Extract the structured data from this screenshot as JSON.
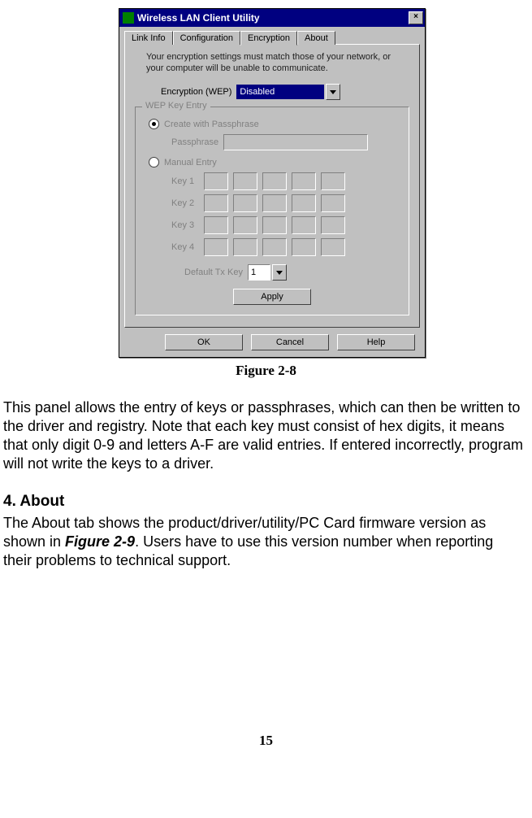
{
  "dialog": {
    "title": "Wireless LAN Client Utility",
    "close_label": "×",
    "tabs": [
      "Link Info",
      "Configuration",
      "Encryption",
      "About"
    ],
    "active_tab_index": 2,
    "message": "Your encryption settings must match those of your network, or your computer will be unable to communicate.",
    "encryption_label": "Encryption (WEP)",
    "encryption_value": "Disabled",
    "group_title": "WEP Key Entry",
    "radio1_label": "Create with Passphrase",
    "radio2_label": "Manual Entry",
    "passphrase_label": "Passphrase",
    "key_labels": [
      "Key 1",
      "Key 2",
      "Key 3",
      "Key 4"
    ],
    "default_key_label": "Default Tx Key",
    "default_key_value": "1",
    "apply_label": "Apply",
    "ok_label": "OK",
    "cancel_label": "Cancel",
    "help_label": "Help"
  },
  "caption": "Figure 2-8",
  "para1": "This panel allows the entry of keys or passphrases, which can then be written to the driver and registry. Note that each key must consist of hex digits, it means that only digit 0-9 and letters A-F are valid entries. If entered incorrectly, program will not write the keys to a driver.",
  "heading_about": "4. About",
  "para2_a": "The About tab shows the product/driver/utility/PC Card firmware version as shown in ",
  "para2_figref": "Figure 2-9",
  "para2_b": ". Users have to use this version number when reporting their problems to technical support.",
  "page_number": "15"
}
